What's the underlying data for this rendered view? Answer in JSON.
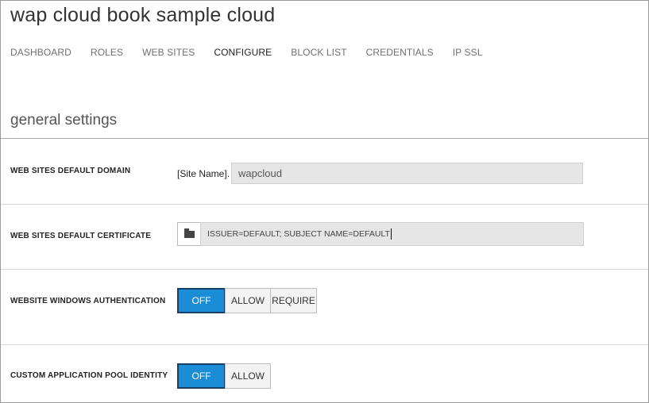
{
  "header": {
    "title": "wap cloud book sample cloud"
  },
  "tabs": [
    {
      "label": "DASHBOARD"
    },
    {
      "label": "ROLES"
    },
    {
      "label": "WEB SITES"
    },
    {
      "label": "CONFIGURE",
      "active": true
    },
    {
      "label": "BLOCK LIST"
    },
    {
      "label": "CREDENTIALS"
    },
    {
      "label": "IP SSL"
    }
  ],
  "section": {
    "title": "general settings"
  },
  "settings": {
    "default_domain": {
      "label": "WEB SITES DEFAULT DOMAIN",
      "prefix": "[Site Name].",
      "value": "wapcloud"
    },
    "default_certificate": {
      "label": "WEB SITES DEFAULT CERTIFICATE",
      "icon": "folder-icon",
      "value": "ISSUER=DEFAULT; SUBJECT NAME=DEFAULT"
    },
    "windows_auth": {
      "label": "WEBSITE WINDOWS AUTHENTICATION",
      "options": [
        "OFF",
        "ALLOW",
        "REQUIRE"
      ],
      "selected": "OFF"
    },
    "app_pool_identity": {
      "label": "CUSTOM APPLICATION POOL IDENTITY",
      "options": [
        "OFF",
        "ALLOW"
      ],
      "selected": "OFF"
    }
  },
  "colors": {
    "toggle_on": "#1b8dd6",
    "toggle_on_border": "#1a3f66"
  }
}
